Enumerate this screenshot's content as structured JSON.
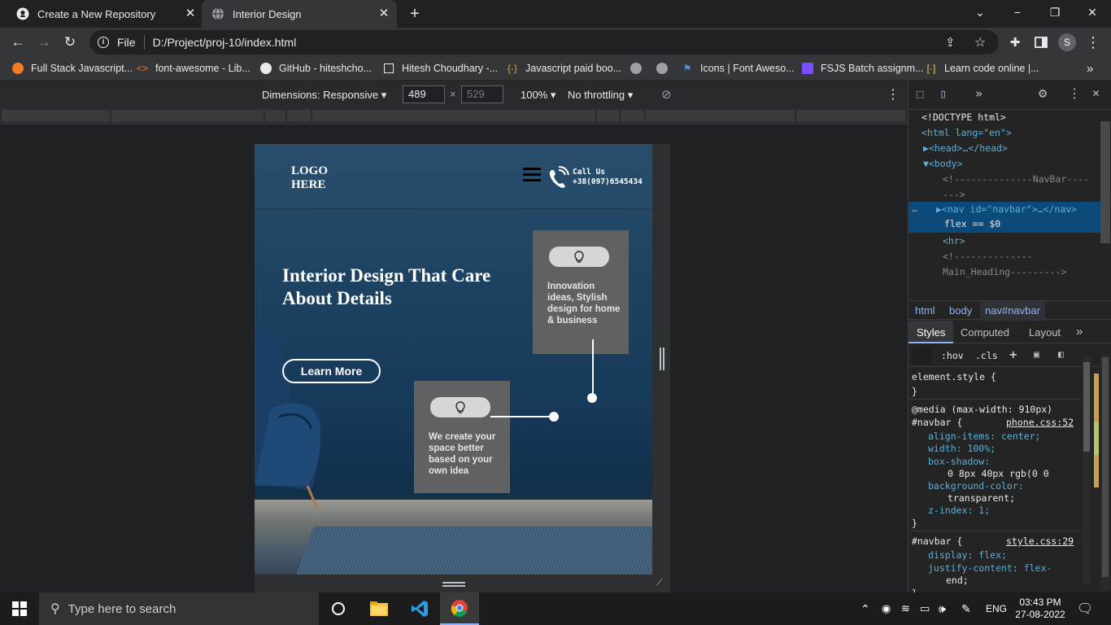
{
  "tabs": [
    {
      "title": "Create a New Repository",
      "icon": "github-icon",
      "active": false
    },
    {
      "title": "Interior Design",
      "icon": "globe-icon",
      "active": true
    }
  ],
  "new_tab_symbol": "+",
  "window_controls": {
    "minimize": "−",
    "maximize": "❐",
    "close": "✕",
    "chevron": "⌄"
  },
  "omnibox": {
    "scheme_label": "File",
    "url": "D:/Project/proj-10/index.html"
  },
  "profile_initial": "S",
  "bookmarks": [
    {
      "label": "Full Stack Javascript...",
      "icon": "firefox-orange-icon"
    },
    {
      "label": "font-awesome - Lib...",
      "icon": "code-brackets-icon"
    },
    {
      "label": "GitHub - hiteshcho...",
      "icon": "github-icon"
    },
    {
      "label": "Hitesh Choudhary -...",
      "icon": "square-icon"
    },
    {
      "label": "Javascript paid boo...",
      "icon": "braces-icon"
    },
    {
      "label": "",
      "icon": "globe-icon"
    },
    {
      "label": "",
      "icon": "globe-icon"
    },
    {
      "label": "Icons | Font Aweso...",
      "icon": "flag-icon"
    },
    {
      "label": "FSJS Batch assignm...",
      "icon": "list-icon"
    },
    {
      "label": "Learn code online |...",
      "icon": "brackets-icon"
    }
  ],
  "bookmarks_more": "»",
  "device_toolbar": {
    "dimensions_label": "Dimensions: Responsive",
    "width": "489",
    "height": "529",
    "times": "×",
    "zoom": "100%",
    "throttling": "No throttling"
  },
  "page": {
    "logo_line1": "LOGO",
    "logo_line2": "HERE",
    "call_label": "Call Us",
    "phone": "+38(097)6545434",
    "hero_heading": "Interior Design That Care About Details",
    "cta_label": "Learn More",
    "card_top_text": "Innovation ideas, Stylish design for home & business",
    "card_bottom_text": "We create your space better based on your own idea"
  },
  "devtools": {
    "dom_lines": [
      {
        "text": "<!DOCTYPE html>",
        "cls": "sel"
      },
      {
        "text": "<html lang=\"en\">",
        "cls": "tag"
      },
      {
        "text": "▶<head>…</head>",
        "cls": "tag"
      },
      {
        "text": "▼<body>",
        "cls": "tag"
      },
      {
        "text": "<!--------------NavBar----",
        "cls": "cmt"
      },
      {
        "text": "--->",
        "cls": "cmt"
      },
      {
        "text": "▶<nav id=\"navbar\">…</nav>",
        "cls": "tag"
      },
      {
        "text": "flex == $0",
        "cls": "sel"
      },
      {
        "text": "<hr>",
        "cls": "tag"
      },
      {
        "text": "<!--------------",
        "cls": "cmt"
      },
      {
        "text": "Main_Heading--------->",
        "cls": "cmt"
      }
    ],
    "breadcrumbs": [
      "html",
      "body",
      "nav#navbar"
    ],
    "panel_tabs": [
      "Styles",
      "Computed",
      "Layout"
    ],
    "filter_buttons": [
      ":hov",
      ".cls",
      "+"
    ],
    "style_lines": [
      {
        "text": "element.style {",
        "cls": "sel"
      },
      {
        "text": "}",
        "cls": "sel"
      },
      {
        "text": "@media (max-width: 910px)",
        "cls": "sel"
      },
      {
        "text": "#navbar {",
        "cls": "sel",
        "source": "phone.css:52"
      },
      {
        "text": "align-items: center;",
        "cls": "prop"
      },
      {
        "text": "width: 100%;",
        "cls": "prop"
      },
      {
        "text": "box-shadow:",
        "cls": "prop"
      },
      {
        "text": "0 8px 40px rgb(0 0",
        "cls": "sel"
      },
      {
        "text": "background-color:",
        "cls": "prop"
      },
      {
        "text": "transparent;",
        "cls": "sel"
      },
      {
        "text": "z-index: 1;",
        "cls": "prop"
      },
      {
        "text": "}",
        "cls": "sel"
      },
      {
        "text": "#navbar {",
        "cls": "sel",
        "source": "style.css:29"
      },
      {
        "text": "display: flex;",
        "cls": "prop"
      },
      {
        "text": "justify-content: flex-",
        "cls": "prop"
      },
      {
        "text": "end;",
        "cls": "sel"
      },
      {
        "text": "}",
        "cls": "sel"
      }
    ]
  },
  "taskbar": {
    "search_placeholder": "Type here to search",
    "language": "ENG",
    "time": "03:43 PM",
    "date": "27-08-2022"
  },
  "colors": {
    "browser_bg": "#202124",
    "toolbar_bg": "#35363a",
    "devtools_selected": "#0b4a7a",
    "card_bg": "#5f6163"
  }
}
